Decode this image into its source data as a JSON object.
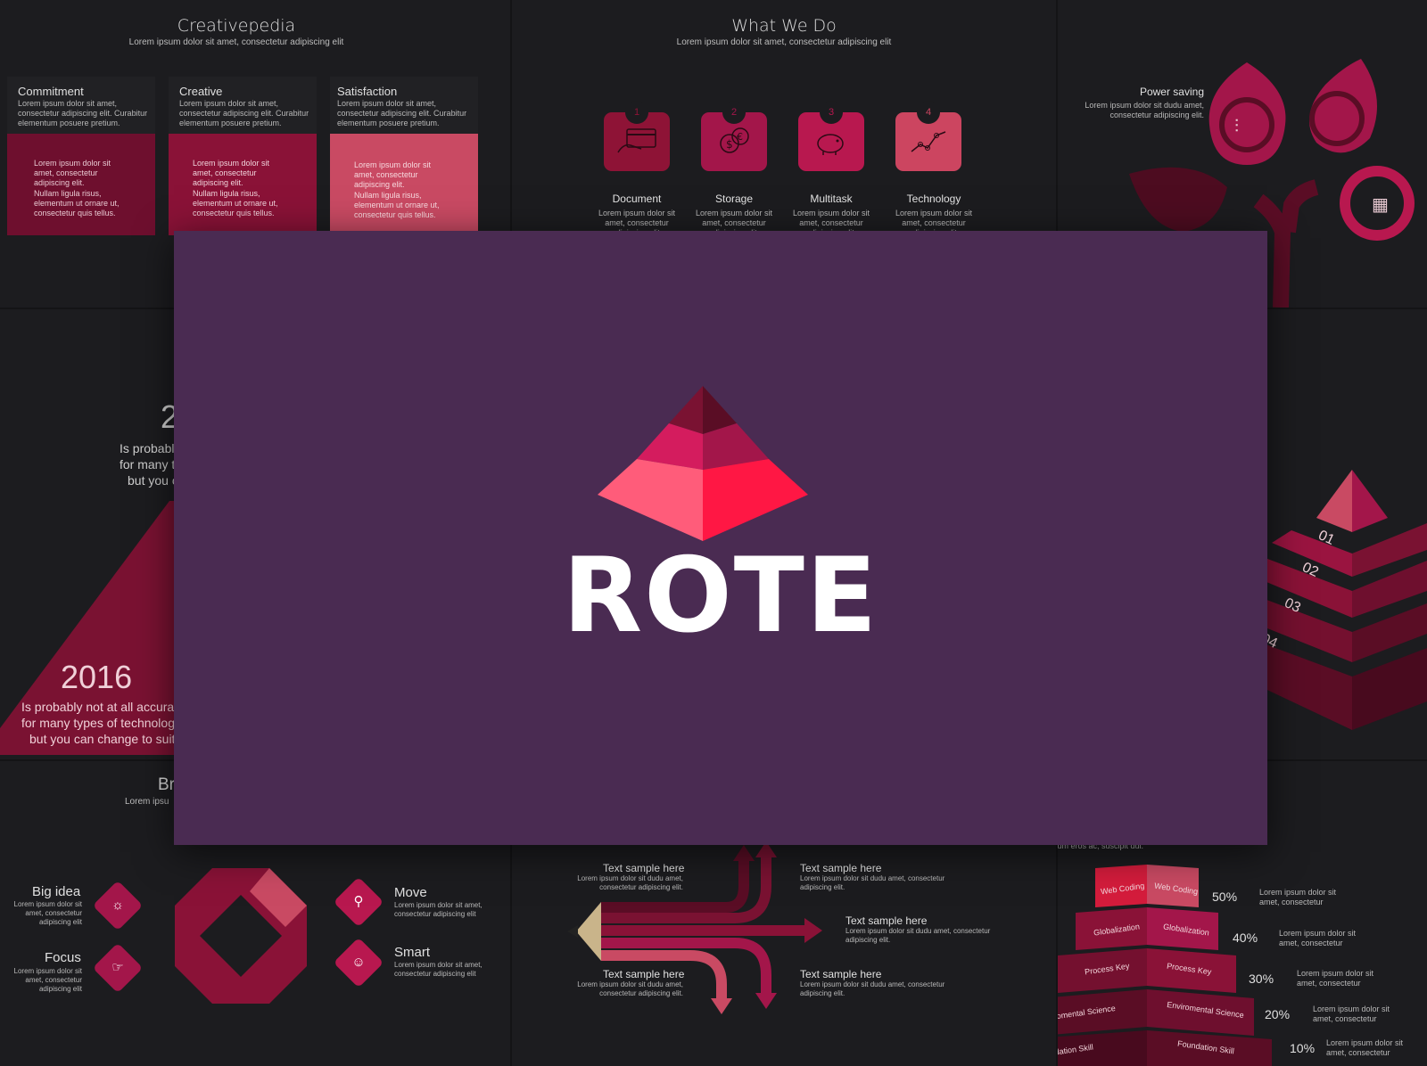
{
  "slide1": {
    "title": "Creativepedia",
    "subtitle": "Lorem ipsum dolor sit amet, consectetur adipiscing elit",
    "cards": [
      {
        "title": "Commitment",
        "text": "Lorem ipsum dolor sit amet, consectetur adipiscing elit. Curabitur elementum posuere pretium.",
        "bullet1": "Lorem ipsum dolor sit amet, consectetur adipiscing elit.",
        "bullet2": "Nullam ligula risus, elementum ut ornare ut, consectetur quis tellus.",
        "color": "#6e0f2e"
      },
      {
        "title": "Creative",
        "text": "Lorem ipsum dolor sit amet, consectetur adipiscing elit. Curabitur elementum posuere pretium.",
        "bullet1": "Lorem ipsum dolor sit amet, consectetur adipiscing elit.",
        "bullet2": "Nullam ligula risus, elementum ut ornare ut, consectetur quis tellus.",
        "color": "#8a1237"
      },
      {
        "title": "Satisfaction",
        "text": "Lorem ipsum dolor sit amet, consectetur adipiscing elit. Curabitur elementum posuere pretium.",
        "bullet1": "Lorem ipsum dolor sit amet, consectetur adipiscing elit.",
        "bullet2": "Nullam ligula risus, elementum ut ornare ut, consectetur quis tellus.",
        "color": "#c94a63"
      }
    ]
  },
  "slide2": {
    "title": "What We Do",
    "subtitle": "Lorem ipsum dolor sit amet, consectetur adipiscing elit",
    "items": [
      {
        "num": "1",
        "label": "Document",
        "text": "Lorem ipsum dolor sit amet, consectetur adipiscing elit.",
        "color": "#8e1336"
      },
      {
        "num": "2",
        "label": "Storage",
        "text": "Lorem ipsum dolor sit amet, consectetur adipiscing elit.",
        "color": "#a3164a"
      },
      {
        "num": "3",
        "label": "Multitask",
        "text": "Lorem ipsum dolor sit amet, consectetur adipiscing elit.",
        "color": "#b8184f"
      },
      {
        "num": "4",
        "label": "Technology",
        "text": "Lorem ipsum dolor sit amet, consectetur adipiscing elit.",
        "color": "#cc4560"
      }
    ]
  },
  "slide3": {
    "label": "Power saving",
    "text": "Lorem ipsum dolor sit dudu amet, consectetur adipiscing elit."
  },
  "slide4": {
    "year_partial": "2",
    "text_partial_1": "Is probabl",
    "text_partial_2": "for many t",
    "text_partial_3": "but you c",
    "year": "2016",
    "text1": "Is probably not at all accurat",
    "text2": "for many types of technolog",
    "text3": "but you can change to suit"
  },
  "slide5": {
    "levels": [
      "01",
      "02",
      "03",
      "04"
    ]
  },
  "slide6": {
    "title_partial": "Br",
    "subtitle_partial": "Lorem ipsu",
    "items": [
      {
        "label": "Big idea",
        "text": "Lorem ipsum dolor sit amet, consectetur adipiscing elit",
        "icon": "lightbulb-icon"
      },
      {
        "label": "Focus",
        "text": "Lorem ipsum dolor sit amet, consectetur adipiscing elit",
        "icon": "pointing-hand-icon"
      },
      {
        "label": "Move",
        "text": "Lorem ipsum dolor sit amet, consectetur adipiscing elit",
        "icon": "running-person-icon"
      },
      {
        "label": "Smart",
        "text": "Lorem ipsum dolor sit amet, consectetur adipiscing elit",
        "icon": "head-profile-icon"
      }
    ]
  },
  "slide7": {
    "samples": [
      {
        "title": "Text sample here",
        "text": "Lorem ipsum dolor sit dudu amet, consectetur adipiscing elit."
      },
      {
        "title": "Text sample here",
        "text": "Lorem ipsum dolor sit dudu amet, consectetur adipiscing elit."
      },
      {
        "title": "Text sample here",
        "text": "Lorem ipsum dolor sit dudu amet, consectetur adipiscing elit."
      },
      {
        "title": "Text sample here",
        "text": "Lorem ipsum dolor sit dudu amet, consectetur adipiscing elit."
      },
      {
        "title": "Text sample here",
        "text": "Lorem ipsum dolor sit dudu amet, consectetur adipiscing elit."
      }
    ]
  },
  "slide8": {
    "top_text": "pretium eros ac, suscipit dui.",
    "layers": [
      "Web Coding",
      "Globalization",
      "Process Key",
      "Enviromental Science",
      "Foundation Skill"
    ],
    "percents": [
      "50%",
      "40%",
      "30%",
      "20%",
      "10%"
    ],
    "texts": [
      "Lorem ipsum dolor sit amet, consectetur",
      "Lorem ipsum dolor sit amet, consectetur",
      "Lorem ipsum dolor sit amet, consectetur",
      "Lorem ipsum dolor sit amet, consectetur",
      "Lorem ipsum dolor sit amet, consectetur"
    ]
  },
  "overlay": {
    "brand": "ROTE",
    "bg": "#4a2b52"
  },
  "colors": {
    "accent_dark": "#6e0f2e",
    "accent": "#a3164a",
    "accent_bright": "#ff1744",
    "accent_pink": "#ff5c7a"
  }
}
